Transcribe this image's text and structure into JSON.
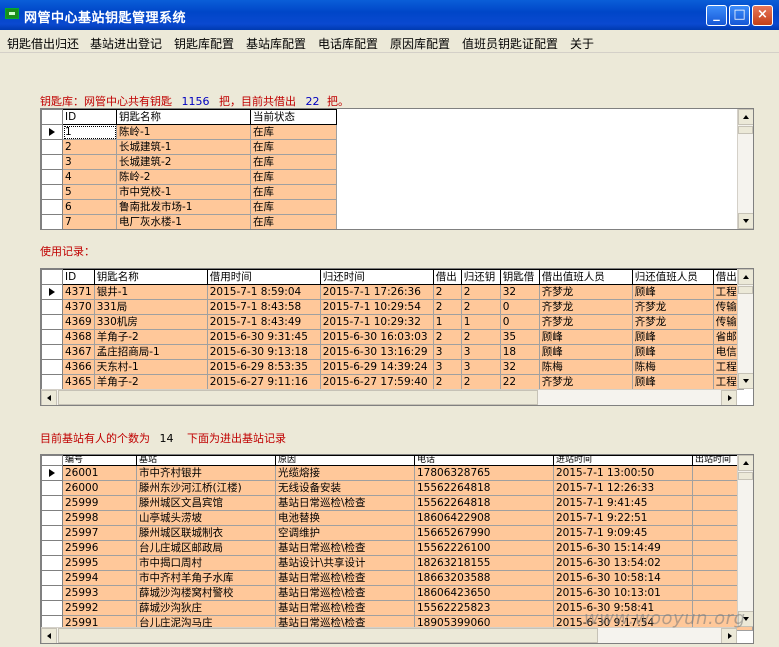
{
  "window": {
    "title": "网管中心基站钥匙管理系统",
    "min": "_",
    "max": "□",
    "close": "×"
  },
  "menu": [
    "钥匙借出归还",
    "基站进出登记",
    "钥匙库配置",
    "基站库配置",
    "电话库配置",
    "原因库配置",
    "值班员钥匙证配置",
    "关于"
  ],
  "keystore": {
    "prefix": "钥匙库：网管中心共有钥匙",
    "total": "1156",
    "mid": "把，目前共借出",
    "lent": "22",
    "suffix": "把。"
  },
  "keys_grid": {
    "headers": [
      "ID",
      "钥匙名称",
      "当前状态"
    ],
    "rows": [
      [
        "1",
        "陈岭-1",
        "在库"
      ],
      [
        "2",
        "长城建筑-1",
        "在库"
      ],
      [
        "3",
        "长城建筑-2",
        "在库"
      ],
      [
        "4",
        "陈岭-2",
        "在库"
      ],
      [
        "5",
        "市中党校-1",
        "在库"
      ],
      [
        "6",
        "鲁南批发市场-1",
        "在库"
      ],
      [
        "7",
        "电厂灰水楼-1",
        "在库"
      ]
    ]
  },
  "usage_label": "使用记录：",
  "usage_grid": {
    "headers": [
      "ID",
      "钥匙名称",
      "借用时间",
      "归还时间",
      "借出",
      "归还钥",
      "钥匙借",
      "借出值班人员",
      "归还值班人员",
      "借出"
    ],
    "rows": [
      [
        "4371",
        "银井-1",
        "2015-7-1  8:59:04",
        "2015-7-1  17:26:36",
        "2",
        "2",
        "32",
        "齐梦龙",
        "顾峰",
        "工程"
      ],
      [
        "4370",
        "331局",
        "2015-7-1  8:43:58",
        "2015-7-1  10:29:54",
        "2",
        "2",
        "0",
        "齐梦龙",
        "齐梦龙",
        "传输"
      ],
      [
        "4369",
        "330机房",
        "2015-7-1  8:43:49",
        "2015-7-1  10:29:32",
        "1",
        "1",
        "0",
        "齐梦龙",
        "齐梦龙",
        "传输"
      ],
      [
        "4368",
        "羊角子-2",
        "2015-6-30  9:31:45",
        "2015-6-30  16:03:03",
        "2",
        "2",
        "35",
        "顾峰",
        "顾峰",
        "省邮"
      ],
      [
        "4367",
        "孟庄招商局-1",
        "2015-6-30  9:13:18",
        "2015-6-30  13:16:29",
        "3",
        "3",
        "18",
        "顾峰",
        "顾峰",
        "电信"
      ],
      [
        "4366",
        "天东村-1",
        "2015-6-29  8:53:35",
        "2015-6-29  14:39:24",
        "3",
        "3",
        "32",
        "陈梅",
        "陈梅",
        "工程"
      ],
      [
        "4365",
        "羊角子-2",
        "2015-6-27  9:11:16",
        "2015-6-27  17:59:40",
        "2",
        "2",
        "22",
        "齐梦龙",
        "顾峰",
        "工程"
      ]
    ]
  },
  "station": {
    "prefix": "目前基站有人的个数为",
    "count": "14",
    "suffix": "下面为进出基站记录"
  },
  "station_grid": {
    "headers": [
      "编号",
      "基站",
      "原因",
      "电话",
      "进站时间",
      "出站时间"
    ],
    "rows": [
      [
        "26001",
        "市中齐村银井",
        "光缆熔接",
        "17806328765",
        "2015-7-1  13:00:50",
        ""
      ],
      [
        "26000",
        "滕州东沙河江桥(江楼)",
        "无线设备安装",
        "15562264818",
        "2015-7-1  12:26:33",
        ""
      ],
      [
        "25999",
        "滕州城区文昌宾馆",
        "基站日常巡检\\检查",
        "15562264818",
        "2015-7-1  9:41:45",
        ""
      ],
      [
        "25998",
        "山亭城头涝坡",
        "电池替换",
        "18606422908",
        "2015-7-1  9:22:51",
        ""
      ],
      [
        "25997",
        "滕州城区联城制衣",
        "空调维护",
        "15665267990",
        "2015-7-1  9:09:45",
        ""
      ],
      [
        "25996",
        "台儿庄城区邮政局",
        "基站日常巡检\\检查",
        "15562226100",
        "2015-6-30  15:14:49",
        ""
      ],
      [
        "25995",
        "市中揭口周村",
        "基站设计\\共享设计",
        "18263218155",
        "2015-6-30  13:54:02",
        ""
      ],
      [
        "25994",
        "市中齐村羊角子水库",
        "基站日常巡检\\检查",
        "18663203588",
        "2015-6-30  10:58:14",
        ""
      ],
      [
        "25993",
        "薛城沙沟楼窝村警校",
        "基站日常巡检\\检查",
        "18606423650",
        "2015-6-30  10:13:01",
        ""
      ],
      [
        "25992",
        "薛城沙沟狄庄",
        "基站日常巡检\\检查",
        "15562225823",
        "2015-6-30  9:58:41",
        ""
      ],
      [
        "25991",
        "台儿庄泥沟马庄",
        "基站日常巡检\\检查",
        "18905399060",
        "2015-6-30  9:17:54",
        ""
      ]
    ]
  },
  "watermark": "www.wooyun.org"
}
